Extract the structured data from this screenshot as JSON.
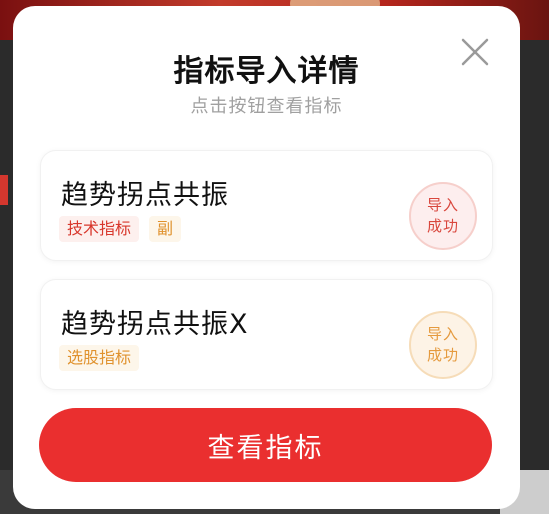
{
  "dialog": {
    "title": "指标导入详情",
    "subtitle": "点击按钮查看指标",
    "close_icon": "close-icon"
  },
  "indicators": [
    {
      "name": "趋势拐点共振",
      "tags": [
        "技术指标",
        "副"
      ],
      "status_line1": "导入",
      "status_line2": "成功",
      "status_color": "#d9473d"
    },
    {
      "name": "趋势拐点共振X",
      "tags": [
        "选股指标"
      ],
      "status_line1": "导入",
      "status_line2": "成功",
      "status_color": "#e59a3e"
    }
  ],
  "actions": {
    "view_label": "查看指标",
    "accent_color": "#ea2f2f"
  }
}
